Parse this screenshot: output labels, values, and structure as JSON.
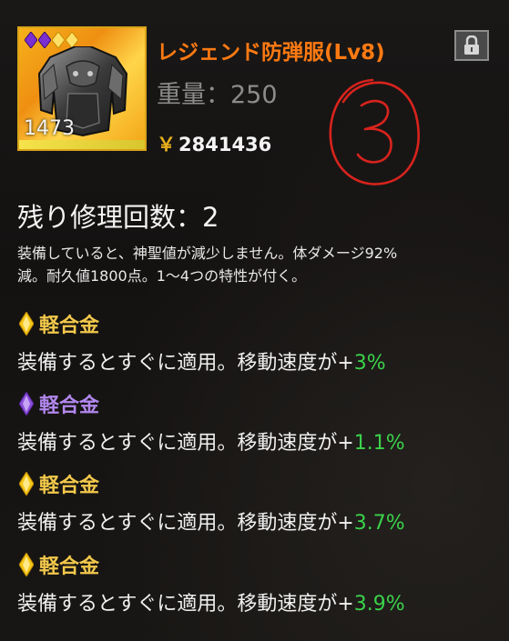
{
  "item": {
    "name": "レジェンド防弾服(Lv8)",
    "number": "1473",
    "weight_label": "重量：",
    "weight_value": "250",
    "price_symbol": "￥",
    "price": "2841436",
    "handwritten_mark": "③"
  },
  "repair": {
    "label": "残り修理回数：",
    "count": "2"
  },
  "description": {
    "line1": "装備していると、神聖値が減少しません。体ダメージ92%",
    "line2": "減。耐久値1800点。1～4つの特性が付く。"
  },
  "traits": [
    {
      "name": "軽合金",
      "gem_color": "#f5c518",
      "name_color": "#f2c84b",
      "text": "装備するとすぐに適用。移動速度が+",
      "value": "3%"
    },
    {
      "name": "軽合金",
      "gem_color": "#8a4fd8",
      "name_color": "#b287ee",
      "text": "装備するとすぐに適用。移動速度が+",
      "value": "1.1%"
    },
    {
      "name": "軽合金",
      "gem_color": "#f5c518",
      "name_color": "#f2c84b",
      "text": "装備するとすぐに適用。移動速度が+",
      "value": "3.7%"
    },
    {
      "name": "軽合金",
      "gem_color": "#f5c518",
      "name_color": "#f2c84b",
      "text": "装備するとすぐに適用。移動速度が+",
      "value": "3.9%"
    }
  ],
  "colors": {
    "name": "#ff7a12",
    "value_green": "#3bd24a",
    "gem_gold": "#f5c518",
    "gem_purple": "#8a4fd8",
    "frame": "#d9a318"
  },
  "icons": {
    "lock": "lock-icon",
    "armor": "armor-vest-icon",
    "rarity": "diamond-gem-icon"
  }
}
